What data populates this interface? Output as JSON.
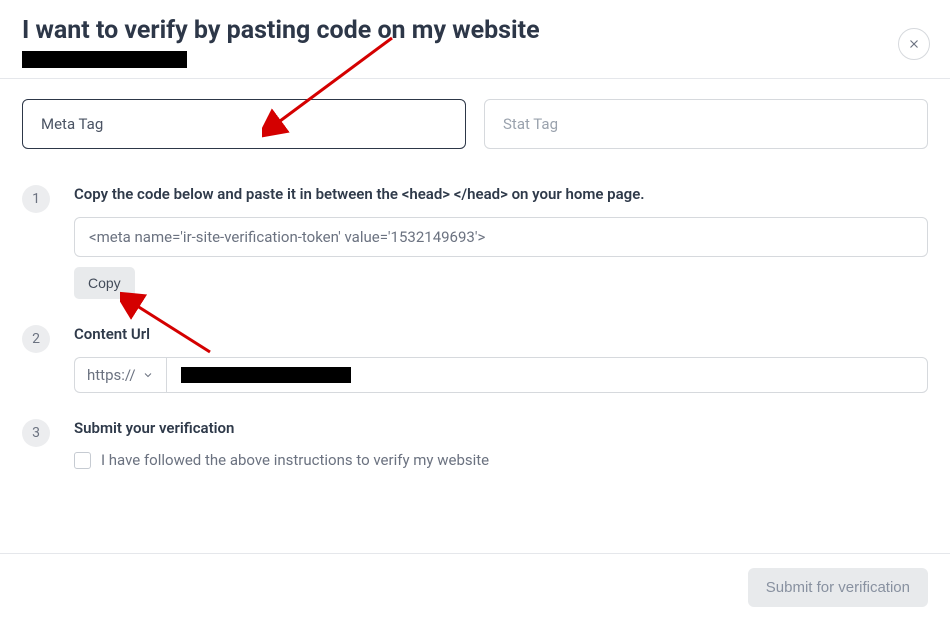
{
  "header": {
    "title": "I want to verify by pasting code on my website"
  },
  "tabs": {
    "meta": "Meta Tag",
    "stat": "Stat Tag"
  },
  "step1": {
    "number": "1",
    "label": "Copy the code below and paste it in between the <head> </head> on your home page.",
    "code": "<meta name='ir-site-verification-token' value='1532149693'>",
    "copy_btn": "Copy"
  },
  "step2": {
    "number": "2",
    "label": "Content Url",
    "protocol": "https://"
  },
  "step3": {
    "number": "3",
    "label": "Submit your verification",
    "checkbox_label": "I have followed the above instructions to verify my website"
  },
  "footer": {
    "submit_btn": "Submit for verification"
  }
}
